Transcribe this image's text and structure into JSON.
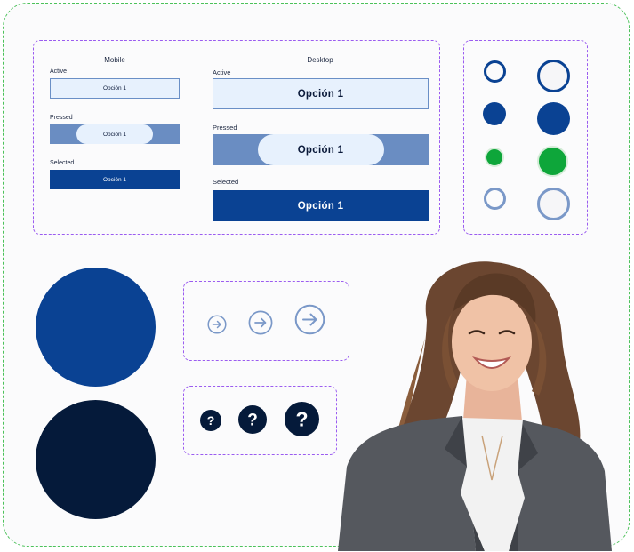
{
  "mobile": {
    "title": "Mobile",
    "active_label": "Active",
    "active_option": "Opción 1",
    "pressed_label": "Pressed",
    "pressed_option": "Opción 1",
    "selected_label": "Selected",
    "selected_option": "Opción 1"
  },
  "desktop": {
    "title": "Desktop",
    "active_label": "Active",
    "active_option": "Opción 1",
    "pressed_label": "Pressed",
    "pressed_option": "Opción 1",
    "selected_label": "Selected",
    "selected_option": "Opción 1"
  },
  "colors": {
    "primary": "#0a4293",
    "primary_light": "#e7f1fd",
    "pressed": "#6a8dc2",
    "success": "#0ea63a",
    "dark_navy": "#051a3a",
    "outline_muted": "#7a98c8",
    "panel_border": "#9b5cf0",
    "outer_border": "#4cc25a"
  },
  "icons": {
    "arrow": "arrow-right-circle-icon",
    "help": "question-circle-icon"
  },
  "photo": "smiling-woman-photo"
}
